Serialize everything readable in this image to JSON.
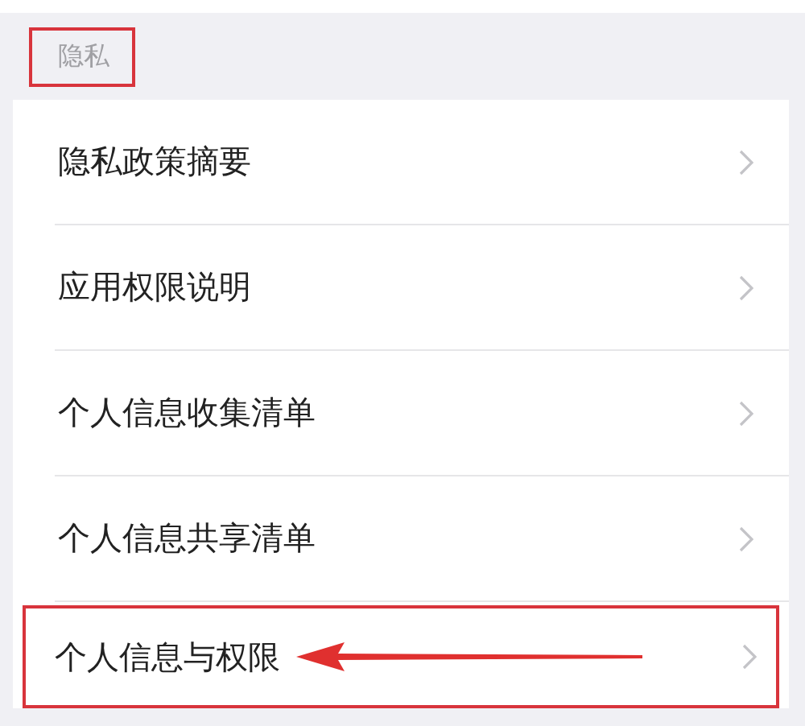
{
  "section": {
    "title": "隐私",
    "annotated": true
  },
  "items": [
    {
      "label": "隐私政策摘要",
      "annotated": false,
      "arrow": false
    },
    {
      "label": "应用权限说明",
      "annotated": false,
      "arrow": false
    },
    {
      "label": "个人信息收集清单",
      "annotated": false,
      "arrow": false
    },
    {
      "label": "个人信息共享清单",
      "annotated": false,
      "arrow": false
    },
    {
      "label": "个人信息与权限",
      "annotated": true,
      "arrow": true
    }
  ]
}
